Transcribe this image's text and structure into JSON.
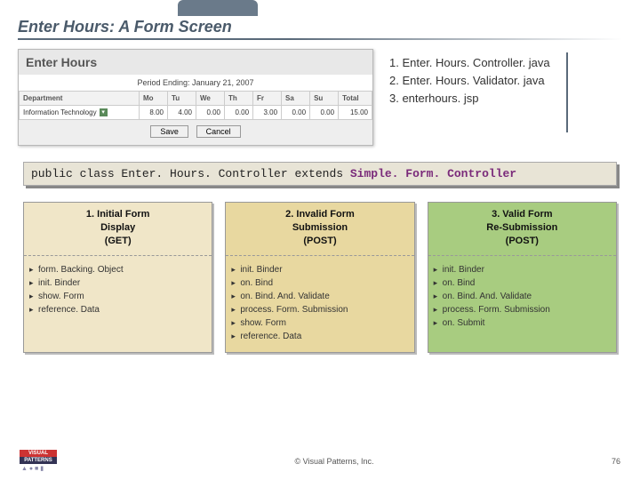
{
  "title": "Enter Hours: A Form Screen",
  "form": {
    "heading": "Enter Hours",
    "period": "Period Ending: January 21, 2007",
    "headers": [
      "Department",
      "Mo",
      "Tu",
      "We",
      "Th",
      "Fr",
      "Sa",
      "Su",
      "Total"
    ],
    "row": {
      "dept": "Information Technology",
      "mo": "8.00",
      "tu": "4.00",
      "we": "0.00",
      "th": "0.00",
      "fr": "3.00",
      "sa": "0.00",
      "su": "0.00",
      "total": "15.00"
    },
    "save": "Save",
    "cancel": "Cancel"
  },
  "files": {
    "f1": "1. Enter. Hours. Controller. java",
    "f2": "2. Enter. Hours. Validator. java",
    "f3": "3. enterhours. jsp"
  },
  "codeline_pre": "public class Enter. Hours. Controller extends ",
  "codeline_cls": "Simple. Form. Controller",
  "columns": {
    "c1": {
      "title_l1": "1. Initial Form",
      "title_l2": "Display",
      "title_l3": "(GET)",
      "items": [
        "form. Backing. Object",
        "init. Binder",
        "show. Form",
        "reference. Data"
      ]
    },
    "c2": {
      "title_l1": "2. Invalid Form",
      "title_l2": "Submission",
      "title_l3": "(POST)",
      "items": [
        "init. Binder",
        "on. Bind",
        "on. Bind. And. Validate",
        "process. Form. Submission",
        "show. Form",
        "reference. Data"
      ]
    },
    "c3": {
      "title_l1": "3. Valid Form",
      "title_l2": "Re-Submission",
      "title_l3": "(POST)",
      "items": [
        "init. Binder",
        "on. Bind",
        "on. Bind. And. Validate",
        "process. Form. Submission",
        "on. Submit"
      ]
    }
  },
  "footer": {
    "logo_top": "VISUAL",
    "logo_bot": "PATTERNS",
    "copyright": "© Visual Patterns, Inc.",
    "page": "76"
  }
}
